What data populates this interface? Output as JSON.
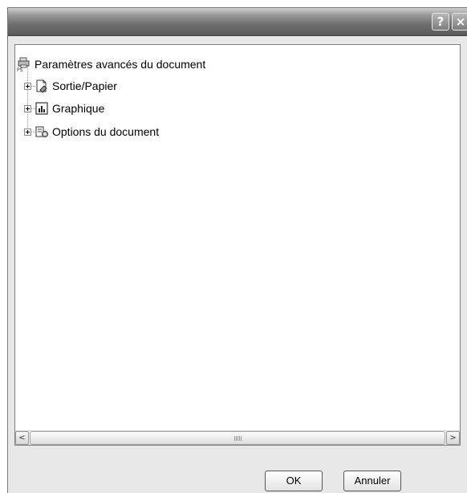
{
  "titlebar": {
    "help_label": "?",
    "close_label": "×"
  },
  "tree": {
    "root": {
      "label": "Paramètres avancés du document",
      "icon": "printer-ps-icon"
    },
    "children": [
      {
        "label": "Sortie/Papier",
        "icon": "paper-output-icon",
        "expanded": false
      },
      {
        "label": "Graphique",
        "icon": "graphics-chart-icon",
        "expanded": false
      },
      {
        "label": "Options du document",
        "icon": "document-options-icon",
        "expanded": false
      }
    ]
  },
  "scrollbar": {
    "left_arrow": "<",
    "right_arrow": ">"
  },
  "buttons": {
    "ok_label": "OK",
    "cancel_label": "Annuler"
  }
}
